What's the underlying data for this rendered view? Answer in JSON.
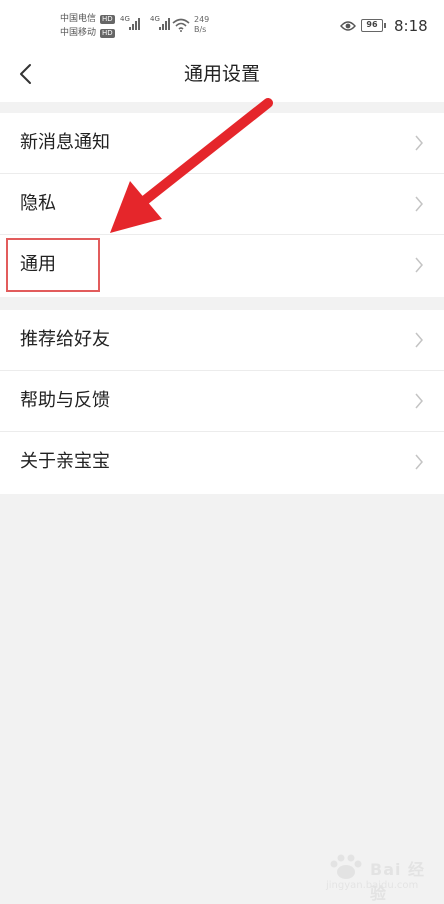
{
  "status_bar": {
    "carrier_1": "中国电信",
    "carrier_2": "中国移动",
    "hd_badge": "HD",
    "network_1": "4G",
    "network_2": "4G",
    "speed_value": "249",
    "speed_unit": "B/s",
    "battery": "96",
    "time": "8:18"
  },
  "nav": {
    "title": "通用设置"
  },
  "groups": [
    {
      "items": [
        {
          "label": "新消息通知"
        },
        {
          "label": "隐私"
        },
        {
          "label": "通用"
        }
      ]
    },
    {
      "items": [
        {
          "label": "推荐给好友"
        },
        {
          "label": "帮助与反馈"
        },
        {
          "label": "关于亲宝宝"
        }
      ]
    }
  ],
  "watermark": {
    "text": "Bai 经验",
    "url": "jingyan.baidu.com"
  },
  "colors": {
    "annotation_red": "#e5262b",
    "highlight_box": "#e25c5c",
    "page_background": "#f2f2f2"
  }
}
